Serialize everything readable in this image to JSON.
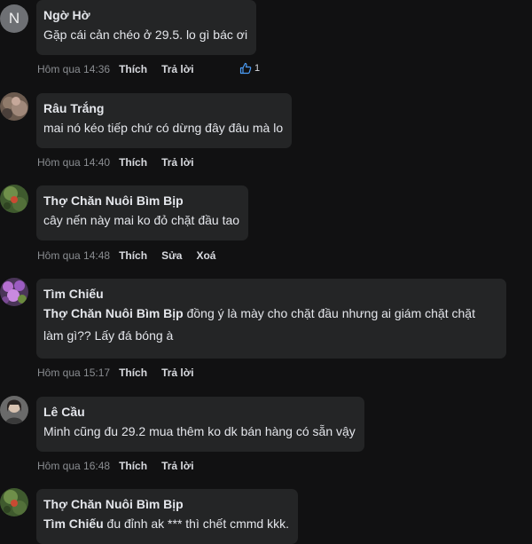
{
  "comments": [
    {
      "author": "Ngờ Hờ",
      "avatar_letter": "N",
      "text": "Gặp cái cản chéo ở 29.5. lo gì bác ơi",
      "time": "Hôm qua 14:36",
      "actions": [
        "Thích",
        "Trả lời"
      ],
      "reaction_count": "1"
    },
    {
      "author": "Râu Trắng",
      "text": "mai nó kéo tiếp chứ có dừng đây đâu mà lo",
      "time": "Hôm qua 14:40",
      "actions": [
        "Thích",
        "Trả lời"
      ]
    },
    {
      "author": "Thợ Chăn Nuôi Bìm Bịp",
      "text": "cây nến này mai ko đỏ chặt đầu tao",
      "time": "Hôm qua 14:48",
      "actions": [
        "Thích",
        "Sửa",
        "Xoá"
      ]
    },
    {
      "author": "Tìm Chiếu",
      "mention": "Thợ Chăn Nuôi Bìm Bịp",
      "text": " đồng ý là mày cho chặt đầu nhưng ai giám chặt chặt làm gì?? Lấy đá bóng à",
      "time": "Hôm qua 15:17",
      "actions": [
        "Thích",
        "Trả lời"
      ]
    },
    {
      "author": "Lê Cầu",
      "text": "Minh cũng đu 29.2 mua thêm ko dk bán hàng có sẵn vậy",
      "time": "Hôm qua 16:48",
      "actions": [
        "Thích",
        "Trả lời"
      ]
    },
    {
      "author": "Thợ Chăn Nuôi Bìm Bịp",
      "mention": "Tìm Chiếu",
      "text": " đu đỉnh ak *** thì chết cmmd kkk."
    }
  ],
  "icons": {
    "reaction": "thumbs-up-icon"
  },
  "colors": {
    "background": "#111112",
    "bubble": "#242526",
    "time": "#8a8d91"
  }
}
